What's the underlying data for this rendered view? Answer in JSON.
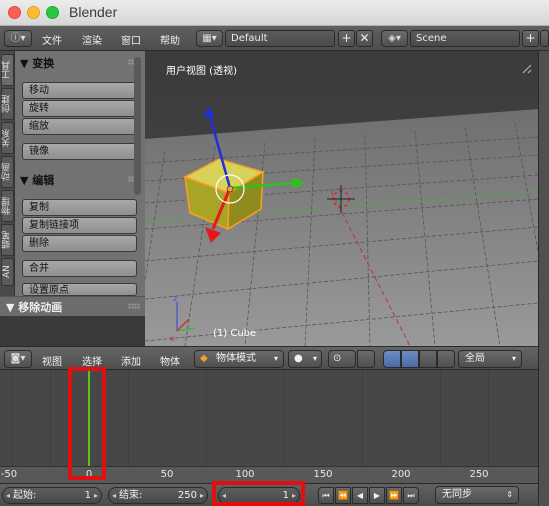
{
  "window": {
    "title": "Blender"
  },
  "infobar": {
    "menus": [
      "文件",
      "渲染",
      "窗口",
      "帮助"
    ],
    "screen_layout": "Default",
    "scene": "Scene"
  },
  "toolshelf": {
    "tabs": [
      "工具",
      "创建",
      "关系",
      "动画",
      "物理",
      "蜡笔",
      "AN"
    ],
    "transform_header": "▼ 变换",
    "transform_buttons": [
      "移动",
      "旋转",
      "缩放",
      "镜像"
    ],
    "edit_header": "▼ 编辑",
    "edit_buttons": [
      "复制",
      "复制链接项",
      "删除",
      "合并",
      "设置原点"
    ],
    "remove_anim_header": "▼ 移除动画"
  },
  "viewport": {
    "view_label": "用户视图 (透视)",
    "object_label": "(1) Cube"
  },
  "view3d_header": {
    "menus": [
      "视图",
      "选择",
      "添加",
      "物体"
    ],
    "mode": "物体模式",
    "orientation": "全局"
  },
  "timeline": {
    "ticks": [
      "-50",
      "0",
      "50",
      "100",
      "150",
      "200",
      "250"
    ],
    "current_frame_marker": 0
  },
  "playback": {
    "start_label": "起始:",
    "start_value": "1",
    "end_label": "结束:",
    "end_value": "250",
    "current_value": "1",
    "sync": "无同步"
  },
  "colors": {
    "selection_highlight": "#e01010",
    "cube": "#b6b127",
    "playhead": "#56c41a"
  }
}
